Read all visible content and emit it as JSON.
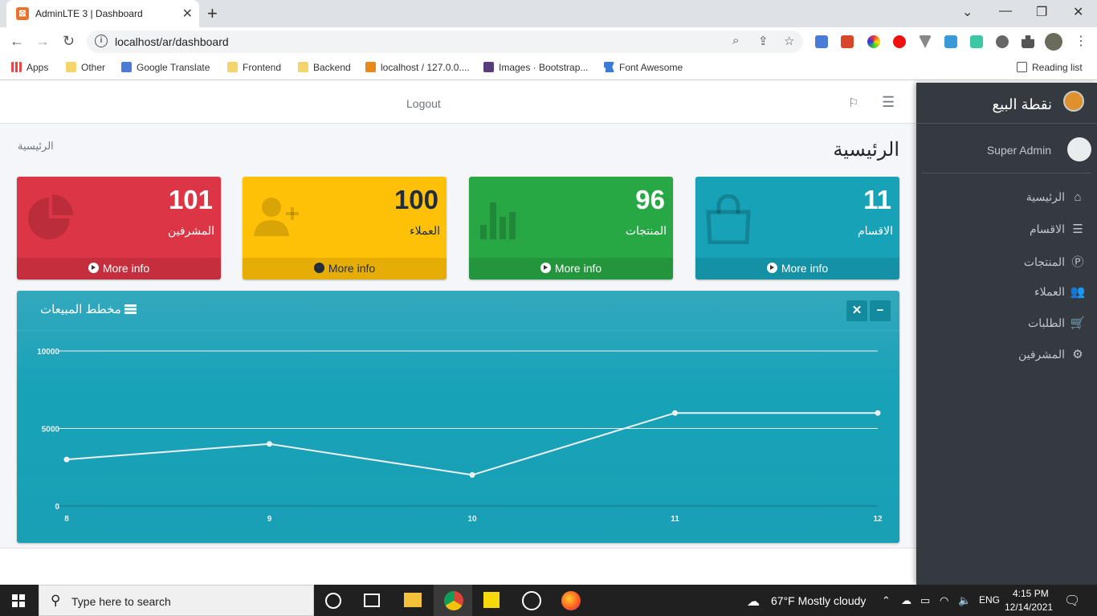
{
  "browser": {
    "tab_title": "AdminLTE 3 | Dashboard",
    "url": "localhost/ar/dashboard",
    "bookmarks": [
      "Apps",
      "Other",
      "Google Translate",
      "Frontend",
      "Backend",
      "localhost / 127.0.0....",
      "Images · Bootstrap...",
      "Font Awesome"
    ],
    "reading_list": "Reading list"
  },
  "navbar": {
    "logout": "Logout"
  },
  "page": {
    "title": "الرئيسية",
    "breadcrumb": "الرئيسية"
  },
  "cards": [
    {
      "number": "11",
      "label": "الاقسام",
      "more": "More info",
      "color": "#17a2b8",
      "icon": "shopping-bag-icon"
    },
    {
      "number": "96",
      "label": "المنتجات",
      "more": "More info",
      "color": "#28a745",
      "icon": "bar-chart-icon"
    },
    {
      "number": "100",
      "label": "العملاء",
      "more": "More info",
      "color": "#ffc107",
      "icon": "user-plus-icon"
    },
    {
      "number": "101",
      "label": "المشرفين",
      "more": "More info",
      "color": "#dc3545",
      "icon": "pie-chart-icon"
    }
  ],
  "sales_card": {
    "title": "مخطط المبيعات"
  },
  "chart_data": {
    "type": "line",
    "title": "مخطط المبيعات",
    "x": [
      "8",
      "9",
      "10",
      "11",
      "12"
    ],
    "values": [
      3000,
      4000,
      2000,
      6000,
      6000
    ],
    "y_ticks": [
      "0",
      "5000",
      "10000"
    ],
    "ylim": [
      0,
      10000
    ],
    "grid": true
  },
  "sidebar": {
    "brand": "نقطة البيع",
    "user": "Super Admin",
    "items": [
      {
        "label": "الرئيسية",
        "icon": "home-icon"
      },
      {
        "label": "الاقسام",
        "icon": "list-icon"
      },
      {
        "label": "المنتجات",
        "icon": "product-icon"
      },
      {
        "label": "العملاء",
        "icon": "users-icon"
      },
      {
        "label": "الطلبات",
        "icon": "cart-icon"
      },
      {
        "label": "المشرفين",
        "icon": "users-cog-icon"
      }
    ]
  },
  "taskbar": {
    "search_placeholder": "Type here to search",
    "weather": "67°F  Mostly cloudy",
    "lang": "ENG",
    "time": "4:15 PM",
    "date": "12/14/2021"
  }
}
